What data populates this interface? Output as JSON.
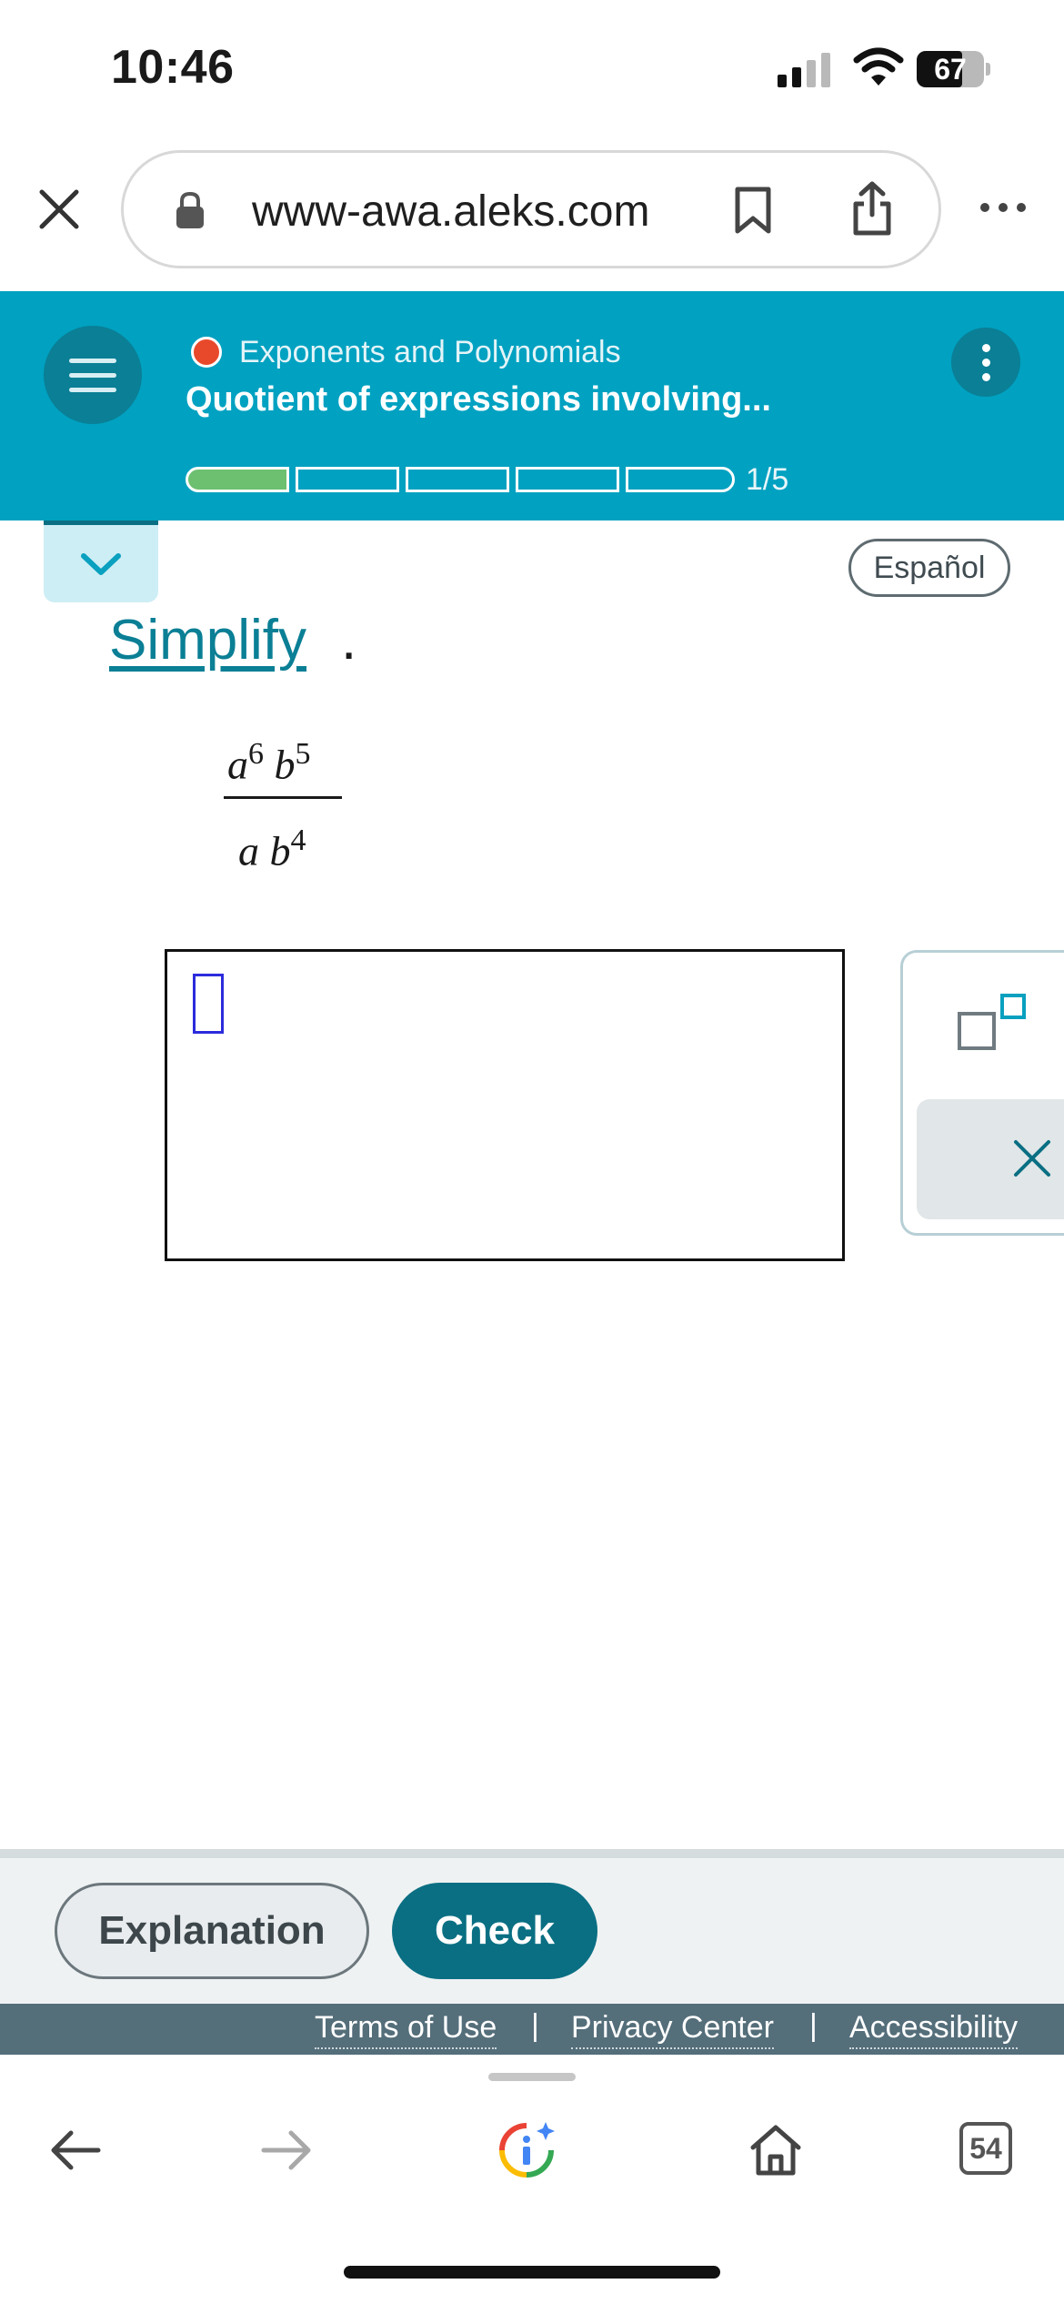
{
  "status_bar": {
    "time": "10:46",
    "battery": "67"
  },
  "browser": {
    "url": "www-awa.aleks.com",
    "tab_count": "54"
  },
  "header": {
    "topic": "Exponents and Polynomials",
    "lesson": "Quotient of expressions involving...",
    "progress_label": "1/5",
    "progress": {
      "completed": 1,
      "total": 5
    },
    "accent": "#00a1c1"
  },
  "content": {
    "language_button": "Español",
    "instruction": "Simplify",
    "instruction_period": ".",
    "expression": {
      "numerator": [
        {
          "base": "a",
          "exp": "6"
        },
        {
          "base": "b",
          "exp": "5"
        }
      ],
      "denominator": [
        {
          "base": "a",
          "exp": ""
        },
        {
          "base": "b",
          "exp": "4"
        }
      ]
    }
  },
  "actions": {
    "explanation": "Explanation",
    "check": "Check"
  },
  "footer": {
    "terms": "Terms of Use",
    "privacy": "Privacy Center",
    "accessibility": "Accessibility",
    "separator": "|"
  },
  "icons": {
    "close": "close-icon",
    "lock": "lock-icon",
    "bookmark": "bookmark-icon",
    "share": "share-icon",
    "more": "more-icon",
    "menu": "menu-icon",
    "kebab": "kebab-icon",
    "chevron": "chevron-down-icon",
    "exponent": "exponent-icon",
    "clear": "clear-icon",
    "back": "back-arrow-icon",
    "forward": "forward-arrow-icon",
    "assistant": "google-assistant-icon",
    "home": "home-icon"
  }
}
